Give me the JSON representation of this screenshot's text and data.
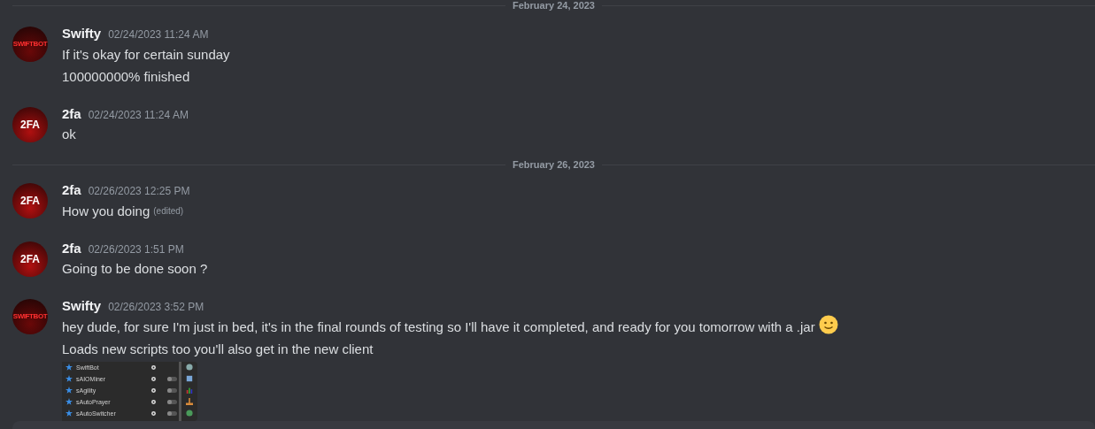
{
  "top_divider": {
    "label": "February 24, 2023"
  },
  "groups": [
    {
      "kind": "message",
      "author": "Swifty",
      "avatar_text": "SWIFTBOT",
      "timestamp": "02/24/2023 11:24 AM",
      "lines": [
        {
          "text": "If it's okay for certain sunday"
        },
        {
          "text": "100000000% finished"
        }
      ]
    },
    {
      "kind": "message",
      "author": "2fa",
      "avatar_text": "2FA",
      "timestamp": "02/24/2023 11:24 AM",
      "lines": [
        {
          "text": "ok"
        }
      ]
    },
    {
      "kind": "divider",
      "label": "February 26, 2023"
    },
    {
      "kind": "message",
      "author": "2fa",
      "avatar_text": "2FA",
      "timestamp": "02/26/2023 12:25 PM",
      "lines": [
        {
          "text": "How you doing",
          "edited": "(edited)"
        }
      ]
    },
    {
      "kind": "message",
      "author": "2fa",
      "avatar_text": "2FA",
      "timestamp": "02/26/2023 1:51 PM",
      "lines": [
        {
          "text": "Going to be done soon ?"
        }
      ]
    },
    {
      "kind": "message",
      "author": "Swifty",
      "avatar_text": "SWIFTBOT",
      "timestamp": "02/26/2023 3:52 PM",
      "lines": [
        {
          "text": "hey dude, for sure I'm just in bed, it's in the final rounds of testing so I'll have it completed, and ready for you tomorrow with a .jar",
          "emoji": true
        },
        {
          "text": "Loads new scripts too you'll also get in the new client"
        }
      ],
      "attachment": {
        "rows": [
          {
            "name": "SwiftBot",
            "kind": "plain"
          },
          {
            "name": "sAIOMiner",
            "kind": "toggle",
            "on": false
          },
          {
            "name": "sAgility",
            "kind": "toggle",
            "on": false
          },
          {
            "name": "sAutoPrayer",
            "kind": "toggle",
            "on": false
          },
          {
            "name": "sAutoSwitcher",
            "kind": "toggle",
            "on": false
          }
        ]
      }
    }
  ]
}
